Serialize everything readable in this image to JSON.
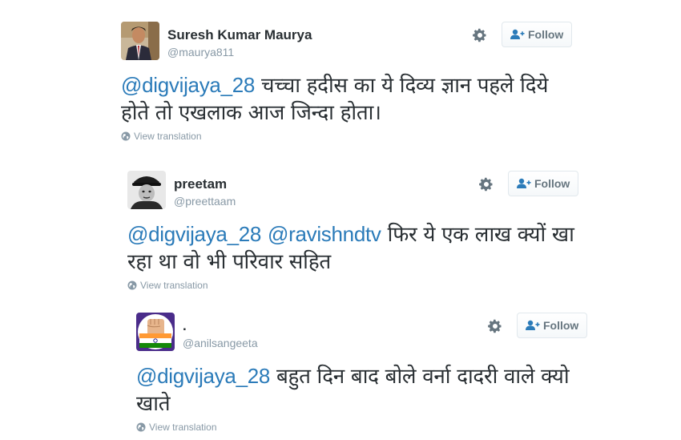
{
  "tweets": [
    {
      "name": "Suresh Kumar Maurya",
      "handle": "@maurya811",
      "follow_label": "Follow",
      "mentions": [
        "@digvijaya_28"
      ],
      "text": "चच्चा हदीस का ये दिव्य ज्ञान पहले दिये होते तो एखलाक आज जिन्दा होता।",
      "translate_label": "View translation",
      "avatar_icon": "person-photo"
    },
    {
      "name": "preetam",
      "handle": "@preettaam",
      "follow_label": "Follow",
      "mentions": [
        "@digvijaya_28",
        "@ravishndtv"
      ],
      "text": "फिर ये एक लाख क्यों खा रहा था वो भी परिवार सहित",
      "translate_label": "View translation",
      "avatar_icon": "bw-person-hat-photo"
    },
    {
      "name": ".",
      "handle": "@anilsangeeta",
      "follow_label": "Follow",
      "mentions": [
        "@digvijaya_28"
      ],
      "text": "बहुत दिन बाद बोले वर्ना दादरी वाले क्यो खाते",
      "translate_label": "View translation",
      "avatar_icon": "fist-tricolor-flag"
    }
  ],
  "colors": {
    "mention": "#2b7bb9",
    "handle": "#8899a6",
    "name": "#292f33",
    "button_border": "#e1e8ed",
    "button_text": "#66757f"
  },
  "icons": [
    "gear-icon",
    "follow-person-plus-icon",
    "globe-icon"
  ]
}
